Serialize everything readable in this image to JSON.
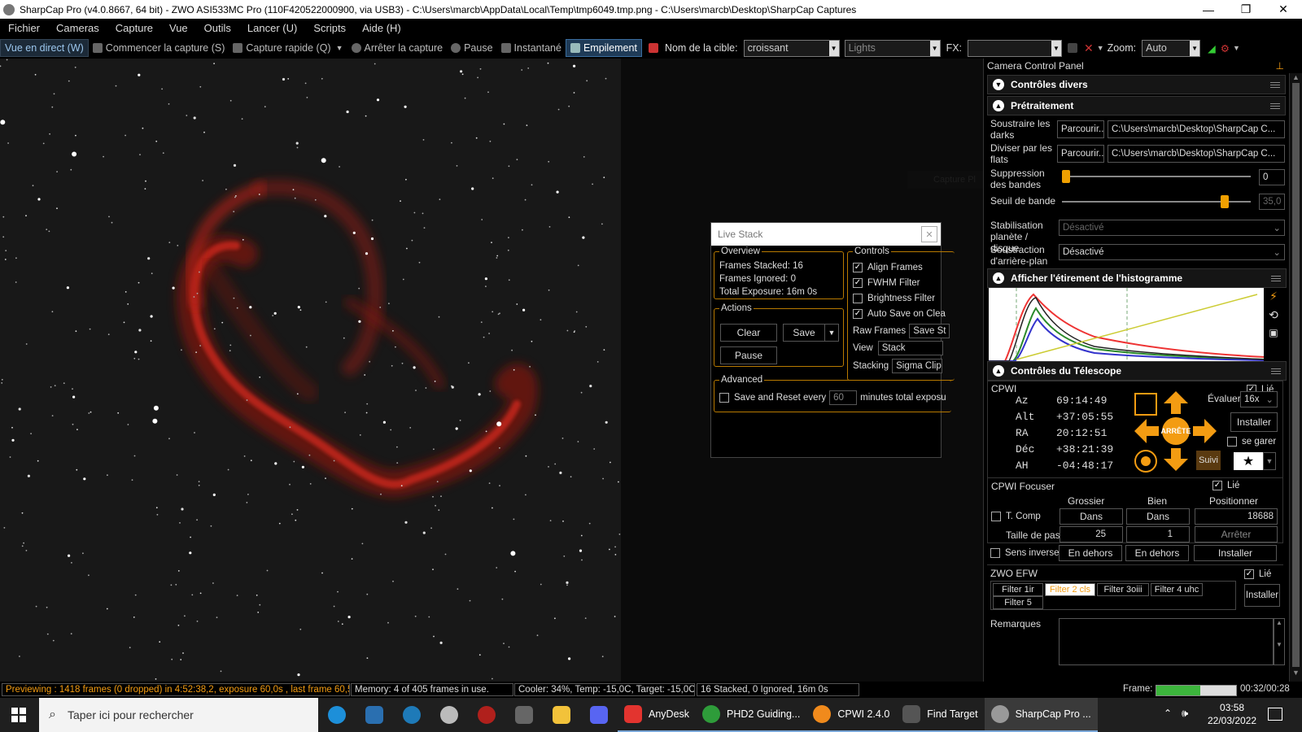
{
  "titlebar": {
    "title": "SharpCap Pro (v4.0.8667, 64 bit) - ZWO ASI533MC Pro (110F420522000900, via USB3) - C:\\Users\\marcb\\AppData\\Local\\Temp\\tmp6049.tmp.png - C:\\Users\\marcb\\Desktop\\SharpCap Captures",
    "minimize": "—",
    "maximize": "❐",
    "close": "✕"
  },
  "menu": [
    "Fichier",
    "Cameras",
    "Capture",
    "Vue",
    "Outils",
    "Lancer (U)",
    "Scripts",
    "Aide (H)"
  ],
  "toolbar": {
    "live_view": "Vue en direct (W)",
    "start_capture": "Commencer la capture (S)",
    "quick_capture": "Capture rapide (Q)",
    "stop_capture": "Arrêter la capture",
    "pause": "Pause",
    "snapshot": "Instantané",
    "stacking": "Empilement",
    "target_label": "Nom de la cible:",
    "target_value": "croissant",
    "frame_type": "Lights",
    "fx_label": "FX:",
    "fx_value": "",
    "zoom_label": "Zoom:",
    "zoom_value": "Auto"
  },
  "live_stack": {
    "title": "Live Stack",
    "overview_label": "Overview",
    "frames_stacked": "Frames Stacked:  16",
    "frames_ignored": "Frames Ignored:  0",
    "total_exposure": "Total Exposure:   16m 0s",
    "actions_label": "Actions",
    "clear": "Clear",
    "save": "Save",
    "pause": "Pause",
    "controls_label": "Controls",
    "align_frames": "Align Frames",
    "fwhm_filter": "FWHM Filter",
    "brightness_filter": "Brightness Filter",
    "auto_save": "Auto Save on Clea",
    "raw_frames_label": "Raw Frames",
    "raw_frames_value": "Save St",
    "view_label": "View",
    "view_value": "Stack",
    "stacking_label": "Stacking",
    "stacking_value": "Sigma Clipp",
    "advanced_label": "Advanced",
    "save_reset": "Save and Reset every",
    "save_reset_value": "60",
    "save_reset_suffix": "minutes total exposu"
  },
  "ghost_text": "Capture Pl",
  "right_panel": {
    "header": "Camera Control Panel",
    "misc_controls": "Contrôles divers",
    "preprocessing": "Prétraitement",
    "darks_label": "Soustraire les darks",
    "flats_label": "Diviser par les flats",
    "browse": "Parcourir...",
    "darks_path": "C:\\Users\\marcb\\Desktop\\SharpCap C...",
    "flats_path": "C:\\Users\\marcb\\Desktop\\SharpCap C...",
    "banding_label": "Suppression des bandes",
    "banding_value": "0",
    "banding_level": 0.0,
    "band_threshold_label": "Seuil de bande",
    "band_threshold_value": "35,0",
    "band_threshold_level": 0.88,
    "stabilization_label": "Stabilisation planète / disque",
    "stabilization_value": "Désactivé",
    "background_label": "Soustraction d'arrière-plan",
    "background_value": "Désactivé",
    "histogram_title": "Afficher l'étirement de l'histogramme",
    "telescope_title": "Contrôles du Télescope",
    "mount_name": "CPWI",
    "linked": "Lié",
    "az_label": "Az",
    "az_value": "69:14:49",
    "alt_label": "Alt",
    "alt_value": "+37:05:55",
    "ra_label": "RA",
    "ra_value": "20:12:51",
    "dec_label": "Déc",
    "dec_value": "+38:21:39",
    "ah_label": "AH",
    "ah_value": "-04:48:17",
    "stop": "ARRÊTE",
    "tracking": "Suivi",
    "rate_label": "Évaluer:",
    "rate_value": "16x",
    "install": "Installer",
    "park": "se garer",
    "focuser_title": "CPWI Focuser",
    "coarse": "Grossier",
    "fine": "Bien",
    "position": "Positionner",
    "tcomp": "T. Comp",
    "in": "Dans",
    "position_value": "18688",
    "step_label": "Taille de pas",
    "coarse_step": "25",
    "fine_step": "1",
    "stop_focuser": "Arrêter",
    "reverse": "Sens inverse",
    "out": "En dehors",
    "efw_title": "ZWO EFW",
    "filters": [
      "Filter 1ir",
      "Filter 2 cls",
      "Filter 3oiii",
      "Filter 4 uhc",
      "Filter 5"
    ],
    "notes_label": "Remarques"
  },
  "statusbar": {
    "previewing": "Previewing : 1418 frames (0 dropped) in 4:52:38,2, exposure 60,0s , last frame 60,5",
    "memory": "Memory: 4 of 405 frames in use.",
    "cooler": "Cooler: 34%, Temp: -15,0C, Target: -15,0C",
    "stacked": "16 Stacked, 0 Ignored, 16m 0s",
    "frame_label": "Frame:",
    "frame_progress": 0.55,
    "frame_time": "00:32/00:28"
  },
  "taskbar": {
    "search": "Taper ici pour rechercher",
    "apps": [
      "AnyDesk",
      "PHD2 Guiding...",
      "CPWI 2.4.0",
      "Find Target",
      "SharpCap Pro ..."
    ],
    "time": "03:58",
    "date": "22/03/2022"
  },
  "colors": {
    "accent_orange": "#f39c12",
    "nebula_red": "#c8281e",
    "selection_blue": "#1f3b57"
  }
}
